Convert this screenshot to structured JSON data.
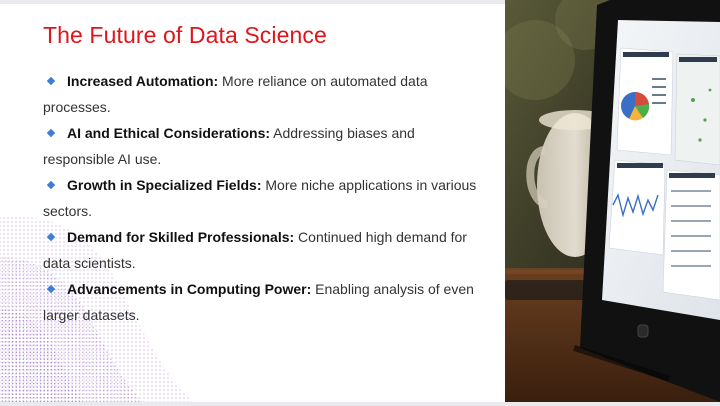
{
  "slide": {
    "title": "The Future of Data Science",
    "bullets": [
      {
        "label": "Increased Automation:",
        "text": " More reliance on automated data processes."
      },
      {
        "label": "AI and Ethical Considerations:",
        "text": " Addressing biases and responsible AI use."
      },
      {
        "label": "Growth in Specialized Fields:",
        "text": " More niche applications in various sectors."
      },
      {
        "label": "Demand for Skilled Professionals:",
        "text": " Continued high demand for data scientists."
      },
      {
        "label": "Advancements in Computing Power:",
        "text": " Enabling analysis of even larger datasets."
      }
    ],
    "image": {
      "subject": "tablet-with-analytics-dashboard",
      "background": "blurred-coffee-cup"
    }
  },
  "colors": {
    "title": "#e0151b",
    "bullet_marker": "#3f7ed8",
    "body_text": "#333333"
  }
}
